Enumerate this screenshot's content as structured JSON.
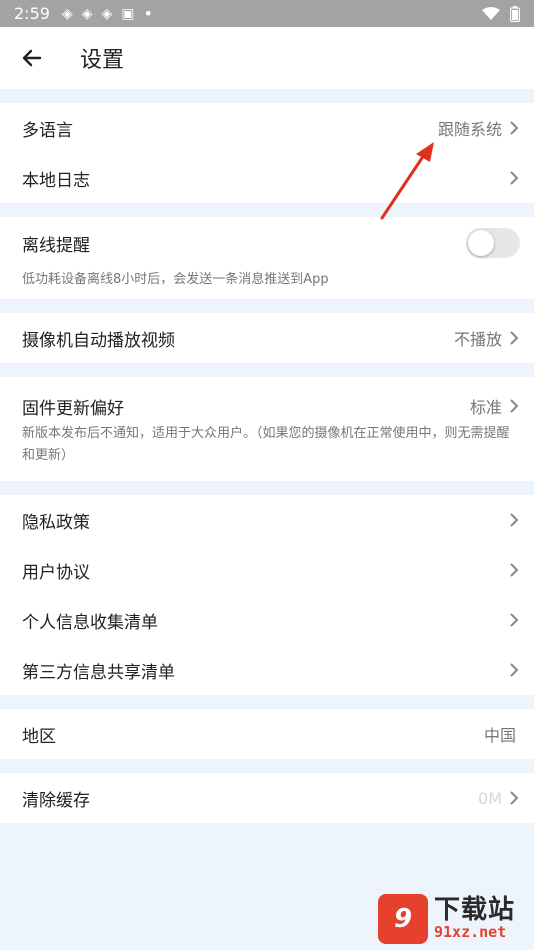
{
  "status_bar": {
    "time": "2:59",
    "dot": "•"
  },
  "header": {
    "title": "设置"
  },
  "sections": {
    "language": {
      "label": "多语言",
      "value": "跟随系统"
    },
    "local_log": {
      "label": "本地日志"
    },
    "offline_alert": {
      "label": "离线提醒",
      "toggle_on": false,
      "desc": "低功耗设备离线8小时后，会发送一条消息推送到App"
    },
    "autoplay": {
      "label": "摄像机自动播放视频",
      "value": "不播放"
    },
    "firmware": {
      "label": "固件更新偏好",
      "value": "标准",
      "desc": "新版本发布后不通知，适用于大众用户。（如果您的摄像机在正常使用中，则无需提醒和更新）"
    },
    "privacy": {
      "label": "隐私政策"
    },
    "user_agreement": {
      "label": "用户协议"
    },
    "personal_info": {
      "label": "个人信息收集清单"
    },
    "third_party": {
      "label": "第三方信息共享清单"
    },
    "region": {
      "label": "地区",
      "value": "中国"
    },
    "cache": {
      "label": "清除缓存",
      "value": "0M"
    }
  },
  "watermark": {
    "badge": "9",
    "title": "下载站",
    "site": "91xz.net"
  },
  "colors": {
    "annotation_arrow": "#e0301e",
    "watermark_red": "#e5412d",
    "status_bar": "#a3a3a3"
  }
}
